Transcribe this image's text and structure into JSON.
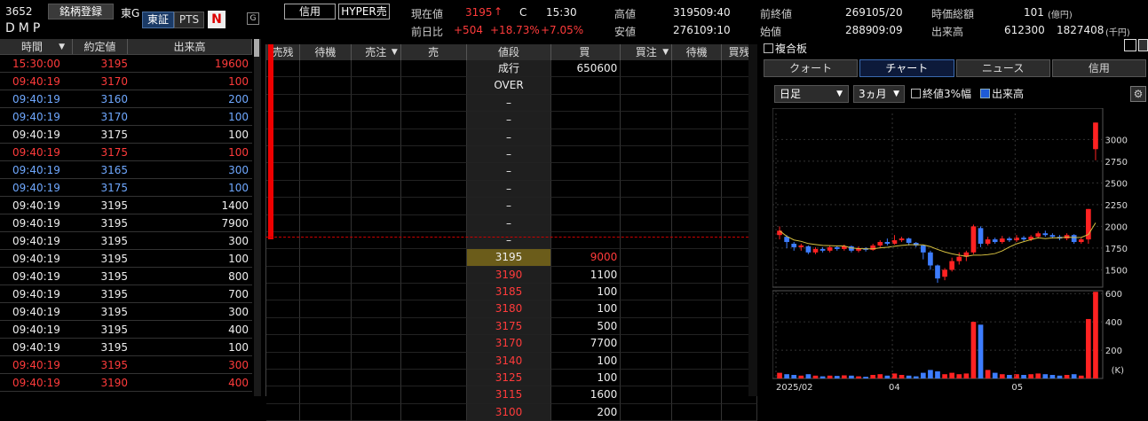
{
  "header": {
    "code": "3652",
    "name": "DMP",
    "register_label": "銘柄登録",
    "market": "東G",
    "tse_label": "東証",
    "pts_label": "PTS",
    "n_icon_label": "N",
    "g_icon_label": "G",
    "credit_label": "信用",
    "hyper_label": "HYPER売",
    "current_price_label": "現在値",
    "current_price": "3195",
    "current_arrow": "↑",
    "current_flag": "C",
    "current_time": "15:30",
    "change_label": "前日比",
    "change": "+504",
    "change_pct": "+18.73%",
    "change_pct2": "+7.05%",
    "high_label": "高値",
    "high": "3195",
    "high_time": "09:40",
    "low_label": "安値",
    "low": "2761",
    "low_time": "09:10",
    "prev_close_label": "前終値",
    "prev_close": "2691",
    "prev_close_date": "05/20",
    "open_label": "始値",
    "open": "2889",
    "open_time": "09:09",
    "market_cap_label": "時価総額",
    "market_cap": "101",
    "market_cap_unit": "(億円)",
    "volume_label": "出来高",
    "volume": "612300",
    "turnover": "1827408",
    "turnover_unit": "(千円)"
  },
  "trades": {
    "headers": [
      "時間",
      "約定値",
      "出来高"
    ],
    "sort_icon": "triangle-down-icon",
    "rows": [
      {
        "time": "15:30:00",
        "price": "3195",
        "vol": "19600",
        "color": "red"
      },
      {
        "time": "09:40:19",
        "price": "3170",
        "vol": "100",
        "color": "red"
      },
      {
        "time": "09:40:19",
        "price": "3160",
        "vol": "200",
        "color": "blue"
      },
      {
        "time": "09:40:19",
        "price": "3170",
        "vol": "100",
        "color": "blue"
      },
      {
        "time": "09:40:19",
        "price": "3175",
        "vol": "100",
        "color": "white"
      },
      {
        "time": "09:40:19",
        "price": "3175",
        "vol": "100",
        "color": "red"
      },
      {
        "time": "09:40:19",
        "price": "3165",
        "vol": "300",
        "color": "blue"
      },
      {
        "time": "09:40:19",
        "price": "3175",
        "vol": "100",
        "color": "blue"
      },
      {
        "time": "09:40:19",
        "price": "3195",
        "vol": "1400",
        "color": "white"
      },
      {
        "time": "09:40:19",
        "price": "3195",
        "vol": "7900",
        "color": "white"
      },
      {
        "time": "09:40:19",
        "price": "3195",
        "vol": "300",
        "color": "white"
      },
      {
        "time": "09:40:19",
        "price": "3195",
        "vol": "100",
        "color": "white"
      },
      {
        "time": "09:40:19",
        "price": "3195",
        "vol": "800",
        "color": "white"
      },
      {
        "time": "09:40:19",
        "price": "3195",
        "vol": "700",
        "color": "white"
      },
      {
        "time": "09:40:19",
        "price": "3195",
        "vol": "300",
        "color": "white"
      },
      {
        "time": "09:40:19",
        "price": "3195",
        "vol": "400",
        "color": "white"
      },
      {
        "time": "09:40:19",
        "price": "3195",
        "vol": "100",
        "color": "white"
      },
      {
        "time": "09:40:19",
        "price": "3195",
        "vol": "300",
        "color": "red"
      },
      {
        "time": "09:40:19",
        "price": "3190",
        "vol": "400",
        "color": "red"
      }
    ]
  },
  "book": {
    "headers": [
      "売残",
      "待機",
      "売注",
      "売",
      "値段",
      "買",
      "買注",
      "待機",
      "買残"
    ],
    "rows": [
      {
        "price": "成行",
        "buy": "650600",
        "pcolor": "white"
      },
      {
        "price": "OVER",
        "buy": "",
        "pcolor": "white"
      },
      {
        "price": "–",
        "buy": "",
        "pcolor": "white"
      },
      {
        "price": "–",
        "buy": "",
        "pcolor": "white"
      },
      {
        "price": "–",
        "buy": "",
        "pcolor": "white"
      },
      {
        "price": "–",
        "buy": "",
        "pcolor": "white"
      },
      {
        "price": "–",
        "buy": "",
        "pcolor": "white"
      },
      {
        "price": "–",
        "buy": "",
        "pcolor": "white"
      },
      {
        "price": "–",
        "buy": "",
        "pcolor": "white"
      },
      {
        "price": "–",
        "buy": "",
        "pcolor": "white"
      },
      {
        "price": "–",
        "buy": "",
        "pcolor": "white"
      },
      {
        "price": "3195",
        "buy": "9000",
        "pcolor": "white",
        "hl": true
      },
      {
        "price": "3190",
        "buy": "1100",
        "pcolor": "red"
      },
      {
        "price": "3185",
        "buy": "100",
        "pcolor": "red"
      },
      {
        "price": "3180",
        "buy": "100",
        "pcolor": "red"
      },
      {
        "price": "3175",
        "buy": "500",
        "pcolor": "red"
      },
      {
        "price": "3170",
        "buy": "7700",
        "pcolor": "red"
      },
      {
        "price": "3140",
        "buy": "100",
        "pcolor": "red"
      },
      {
        "price": "3125",
        "buy": "100",
        "pcolor": "red"
      },
      {
        "price": "3115",
        "buy": "1600",
        "pcolor": "red"
      },
      {
        "price": "3100",
        "buy": "200",
        "pcolor": "red"
      }
    ]
  },
  "right": {
    "compound_label": "複合板",
    "tabs": [
      "クォート",
      "チャート",
      "ニュース",
      "信用"
    ],
    "period": "日足",
    "range": "3ヵ月",
    "chk1": "終値3%幅",
    "chk2": "出来高",
    "settings_icon": "gear-icon"
  },
  "chart_data": {
    "type": "candlestick",
    "price_ticks": [
      "3000",
      "2750",
      "2500",
      "2250",
      "2000",
      "1750",
      "1500"
    ],
    "price_ylim": [
      1300,
      3300
    ],
    "volume_ticks": [
      "600",
      "400",
      "200"
    ],
    "volume_unit": "(K)",
    "volume_ylim": [
      0,
      620
    ],
    "x_ticks": [
      "2025/02",
      "04",
      "05"
    ],
    "candles": [
      {
        "o": 1900,
        "c": 1950,
        "h": 2000,
        "l": 1850,
        "v": 40
      },
      {
        "o": 1880,
        "c": 1820,
        "h": 1900,
        "l": 1750,
        "v": 30
      },
      {
        "o": 1800,
        "c": 1760,
        "h": 1820,
        "l": 1720,
        "v": 25
      },
      {
        "o": 1760,
        "c": 1780,
        "h": 1800,
        "l": 1720,
        "v": 20
      },
      {
        "o": 1770,
        "c": 1700,
        "h": 1780,
        "l": 1680,
        "v": 30
      },
      {
        "o": 1700,
        "c": 1740,
        "h": 1760,
        "l": 1680,
        "v": 20
      },
      {
        "o": 1740,
        "c": 1720,
        "h": 1760,
        "l": 1700,
        "v": 15
      },
      {
        "o": 1720,
        "c": 1760,
        "h": 1780,
        "l": 1700,
        "v": 20
      },
      {
        "o": 1760,
        "c": 1740,
        "h": 1780,
        "l": 1720,
        "v": 18
      },
      {
        "o": 1740,
        "c": 1770,
        "h": 1790,
        "l": 1720,
        "v": 22
      },
      {
        "o": 1770,
        "c": 1720,
        "h": 1780,
        "l": 1700,
        "v": 20
      },
      {
        "o": 1720,
        "c": 1750,
        "h": 1770,
        "l": 1700,
        "v": 15
      },
      {
        "o": 1750,
        "c": 1730,
        "h": 1760,
        "l": 1710,
        "v": 12
      },
      {
        "o": 1730,
        "c": 1780,
        "h": 1800,
        "l": 1720,
        "v": 25
      },
      {
        "o": 1780,
        "c": 1820,
        "h": 1840,
        "l": 1760,
        "v": 30
      },
      {
        "o": 1820,
        "c": 1800,
        "h": 1860,
        "l": 1780,
        "v": 20
      },
      {
        "o": 1800,
        "c": 1840,
        "h": 1900,
        "l": 1790,
        "v": 35
      },
      {
        "o": 1840,
        "c": 1860,
        "h": 1880,
        "l": 1820,
        "v": 25
      },
      {
        "o": 1860,
        "c": 1810,
        "h": 1870,
        "l": 1780,
        "v": 20
      },
      {
        "o": 1810,
        "c": 1780,
        "h": 1820,
        "l": 1760,
        "v": 15
      },
      {
        "o": 1780,
        "c": 1700,
        "h": 1790,
        "l": 1620,
        "v": 40
      },
      {
        "o": 1700,
        "c": 1550,
        "h": 1720,
        "l": 1500,
        "v": 60
      },
      {
        "o": 1550,
        "c": 1400,
        "h": 1560,
        "l": 1350,
        "v": 50
      },
      {
        "o": 1420,
        "c": 1500,
        "h": 1520,
        "l": 1380,
        "v": 30
      },
      {
        "o": 1500,
        "c": 1600,
        "h": 1640,
        "l": 1480,
        "v": 40
      },
      {
        "o": 1600,
        "c": 1650,
        "h": 1700,
        "l": 1560,
        "v": 30
      },
      {
        "o": 1650,
        "c": 1700,
        "h": 1720,
        "l": 1600,
        "v": 35
      },
      {
        "o": 1700,
        "c": 2000,
        "h": 2020,
        "l": 1680,
        "v": 400
      },
      {
        "o": 1980,
        "c": 1800,
        "h": 2000,
        "l": 1760,
        "v": 380
      },
      {
        "o": 1800,
        "c": 1850,
        "h": 1880,
        "l": 1780,
        "v": 60
      },
      {
        "o": 1850,
        "c": 1820,
        "h": 1870,
        "l": 1800,
        "v": 40
      },
      {
        "o": 1820,
        "c": 1860,
        "h": 1890,
        "l": 1800,
        "v": 30
      },
      {
        "o": 1860,
        "c": 1840,
        "h": 1880,
        "l": 1820,
        "v": 25
      },
      {
        "o": 1840,
        "c": 1870,
        "h": 1900,
        "l": 1820,
        "v": 30
      },
      {
        "o": 1870,
        "c": 1850,
        "h": 1890,
        "l": 1830,
        "v": 25
      },
      {
        "o": 1850,
        "c": 1880,
        "h": 1900,
        "l": 1830,
        "v": 30
      },
      {
        "o": 1880,
        "c": 1920,
        "h": 1940,
        "l": 1860,
        "v": 35
      },
      {
        "o": 1920,
        "c": 1900,
        "h": 1950,
        "l": 1880,
        "v": 30
      },
      {
        "o": 1900,
        "c": 1880,
        "h": 1920,
        "l": 1860,
        "v": 25
      },
      {
        "o": 1880,
        "c": 1860,
        "h": 1900,
        "l": 1840,
        "v": 20
      },
      {
        "o": 1860,
        "c": 1900,
        "h": 1920,
        "l": 1840,
        "v": 25
      },
      {
        "o": 1900,
        "c": 1820,
        "h": 1910,
        "l": 1800,
        "v": 30
      },
      {
        "o": 1820,
        "c": 1850,
        "h": 1870,
        "l": 1800,
        "v": 20
      },
      {
        "o": 1850,
        "c": 2200,
        "h": 2200,
        "l": 1800,
        "v": 420
      },
      {
        "o": 2889,
        "c": 3195,
        "h": 3195,
        "l": 2761,
        "v": 612
      }
    ]
  }
}
